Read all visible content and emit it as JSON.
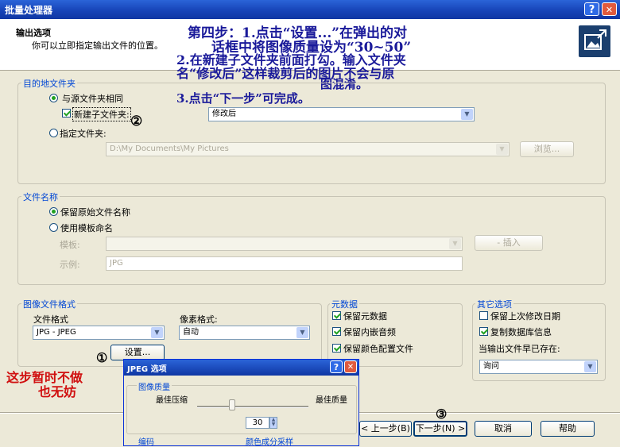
{
  "window": {
    "title": "批量处理器",
    "help_glyph": "?",
    "close_glyph": "✕"
  },
  "header": {
    "title": "输出选项",
    "subtitle": "你可以立即指定输出文件的位置。"
  },
  "annotations": {
    "step_line1": "第四步：1.点击“设置...”在弹出的对",
    "step_line2": "话框中将图像质量设为“30~50”",
    "step_line3": "2.在新建子文件夹前面打勾。输入文件夹",
    "step_line4": "名“修改后”这样裁剪后的图片不会与原",
    "step_line5": "图混淆。",
    "step_line6": "3.点击“下一步”可完成。",
    "marker1": "①",
    "marker2": "②",
    "marker3": "③",
    "note_line1": "这步暂时不做",
    "note_line2": "也无妨"
  },
  "destination": {
    "label": "目的地文件夹",
    "same_as_source": "与源文件夹相同",
    "new_subfolder": "新建子文件夹:",
    "subfolder_value": "修改后",
    "specify_folder": "指定文件夹:",
    "folder_path": "D:\\My Documents\\My Pictures",
    "browse": "浏览..."
  },
  "filename": {
    "label": "文件名称",
    "keep_original": "保留原始文件名称",
    "use_template": "使用模板命名",
    "template_label": "模板:",
    "insert": "- 插入",
    "example_label": "示例:",
    "example_value": "JPG"
  },
  "format": {
    "label": "图像文件格式",
    "file_format_label": "文件格式",
    "file_format_value": "JPG - JPEG",
    "pixel_format_label": "像素格式:",
    "pixel_format_value": "自动",
    "settings": "设置..."
  },
  "metadata": {
    "label": "元数据",
    "keep_metadata": "保留元数据",
    "keep_audio": "保留内嵌音频",
    "keep_color_profile": "保留颜色配置文件"
  },
  "other": {
    "label": "其它选项",
    "keep_modified_date": "保留上次修改日期",
    "copy_db_info": "复制数据库信息",
    "exists_label": "当输出文件早已存在:",
    "exists_value": "询问"
  },
  "jpeg_dialog": {
    "title": "JPEG 选项",
    "quality_label": "图像质量",
    "best_compress": "最佳压缩",
    "best_quality": "最佳质量",
    "quality_value": "30",
    "quality_percent": 30,
    "encode_label": "编码",
    "chroma_label": "颜色成分采样"
  },
  "nav": {
    "back": "< 上一步(B)",
    "next": "下一步(N) >",
    "cancel": "取消",
    "help": "帮助"
  }
}
